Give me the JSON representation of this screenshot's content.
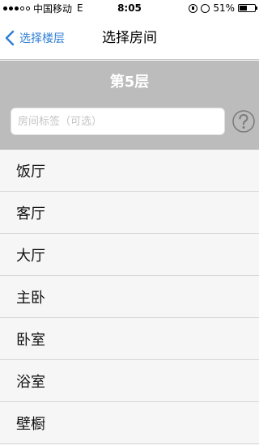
{
  "status_bar": {
    "carrier": "中国移动",
    "network": "E",
    "time": "8:05",
    "battery": "51%",
    "battery_level": 0.51
  },
  "nav": {
    "back_label": "选择楼层",
    "title": "选择房间"
  },
  "floor": {
    "title": "第5层",
    "tag_placeholder": "房间标签（可选）"
  },
  "rooms": [
    {
      "label": "饭厅"
    },
    {
      "label": "客厅"
    },
    {
      "label": "大厅"
    },
    {
      "label": "主卧"
    },
    {
      "label": "卧室"
    },
    {
      "label": "浴室"
    },
    {
      "label": "壁橱"
    }
  ],
  "colors": {
    "accent": "#2f7fd4",
    "panel_bg": "#bcbcbc",
    "list_bg": "#f6f6f6"
  }
}
